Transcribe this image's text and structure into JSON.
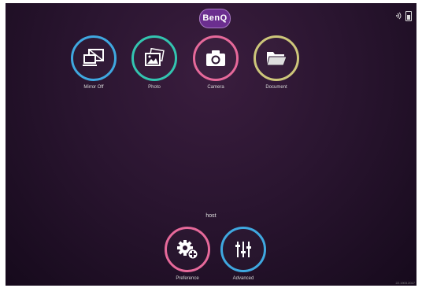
{
  "brand": {
    "logo_text": "BenQ",
    "color": "#6b2e8f"
  },
  "status_bar": {
    "icons": [
      "wireless-projection-icon",
      "battery-icon"
    ]
  },
  "apps": [
    {
      "label": "Mirror Off",
      "icon": "mirror-off-icon",
      "color": "#3fa8e0"
    },
    {
      "label": "Photo",
      "icon": "photo-icon",
      "color": "#33c4b0"
    },
    {
      "label": "Camera",
      "icon": "camera-icon",
      "color": "#e6699a"
    },
    {
      "label": "Document",
      "icon": "folder-icon",
      "color": "#cdc67a"
    }
  ],
  "host": {
    "name": "host"
  },
  "bottom_apps": [
    {
      "label": "Preference",
      "icon": "gear-add-icon",
      "color": "#e6699a"
    },
    {
      "label": "Advanced",
      "icon": "sliders-icon",
      "color": "#3fa8e0"
    }
  ],
  "version": "22.1903.2017"
}
